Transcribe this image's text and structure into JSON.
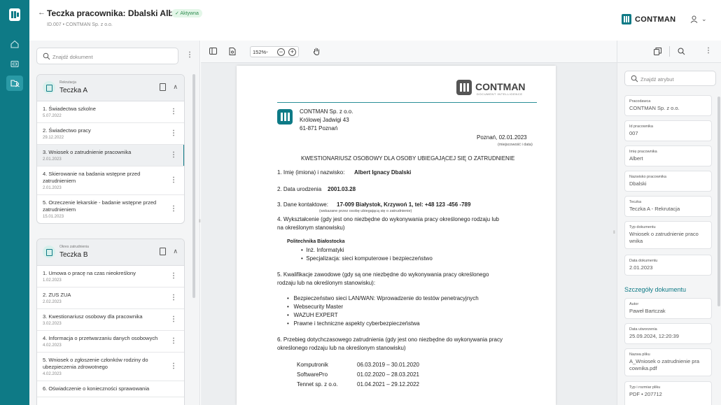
{
  "header": {
    "back_label": "←",
    "title": "Teczka pracownika: Dbalski Albert",
    "badge": "✓ Aktywna",
    "subtitle": "ID.007 • CONTMAN Sp. z o.o.",
    "brand": "CONTMAN",
    "user_chevron": "⌄"
  },
  "left_panel": {
    "search_placeholder": "Znajdź dokument",
    "groups": [
      {
        "category": "Rekrutacja",
        "name": "Teczka A",
        "items": [
          {
            "title": "1. Świadectwa szkolne",
            "date": "5.07.2022"
          },
          {
            "title": "2. Świadectwo pracy",
            "date": "29.12.2022"
          },
          {
            "title": "3. Wniosek o zatrudnienie pracownika",
            "date": "2.01.2023"
          },
          {
            "title": "4. Skierowanie na badania wstępne przed zatrudnieniem",
            "date": "2.01.2023"
          },
          {
            "title": "5. Orzeczenie lekarskie - badanie wstępne przed zatrudnieniem",
            "date": "15.01.2023"
          }
        ]
      },
      {
        "category": "Okres zatrudnienia",
        "name": "Teczka B",
        "items": [
          {
            "title": "1. Umowa o pracę na czas nieokreślony",
            "date": "1.02.2023"
          },
          {
            "title": "2. ZUS ZUA",
            "date": "2.02.2023"
          },
          {
            "title": "3. Kwestionariusz osobowy dla pracownika",
            "date": "3.02.2023"
          },
          {
            "title": "4. Informacja o przetwarzaniu danych osobowych",
            "date": "4.02.2023"
          },
          {
            "title": "5. Wniosek o zgłoszenie członków rodziny do ubezpieczenia zdrowotnego",
            "date": "4.02.2023"
          },
          {
            "title": "6. Oświadczenie o konieczności sprawowania",
            "date": ""
          }
        ]
      }
    ]
  },
  "viewer": {
    "zoom": "152%",
    "zoom_chevron": "⌄",
    "zoom_out": "−",
    "zoom_in": "+",
    "document": {
      "logo_text": "CONTMAN",
      "logo_sub": "DOCUMENT INTELLIGENCE",
      "sender_name": "CONTMAN Sp. z o.o.",
      "sender_street": "Królowej Jadwigi 43",
      "sender_city": "61-871 Poznań",
      "place_date": "Poznań, 02.01.2023",
      "place_date_hint": "(miejscowość i data)",
      "heading": "KWESTIONARIUSZ OSOBOWY DLA OSOBY UBIEGAJĄCEJ SIĘ O ZATRUDNIENIE",
      "q1_label": "1. Imię (imiona) i nazwisko:",
      "q1_value": "Albert Ignacy Dbalski",
      "q2_label": "2. Data urodzenia",
      "q2_value": "2001.03.28",
      "q3_label": "3. Dane kontaktowe:",
      "q3_value": "17-009 Białystok, Krzywoń 1, tel: +48 123 -456 -789",
      "q3_hint": "(wskazane przez osobę ubiegającą się o zatrudnienie)",
      "q4_line1": "4. Wykształcenie (gdy jest ono niezbędne do wykonywania pracy określonego rodzaju lub",
      "q4_line2": "na określonym stanowisku)",
      "school": "Politechnika Białostocka",
      "school_items": [
        "Inż. Informatyki",
        "Specjalizacja: sieci komputerowe i bezpieczeństwo"
      ],
      "q5_line1": "5. Kwalifikacje zawodowe (gdy są one niezbędne do wykonywania pracy określonego",
      "q5_line2": "rodzaju lub na określonym stanowisku):",
      "qualifications": [
        "Bezpieczeństwo sieci LAN/WAN: Wprowadzenie do testów penetracyjnych",
        "Websecurity Master",
        "WAZUH EXPERT",
        "Prawne i techniczne aspekty cyberbezpieczeństwa"
      ],
      "q6_line1": "6. Przebieg dotychczasowego zatrudnienia (gdy jest ono niezbędne do wykonywania pracy",
      "q6_line2": "określonego rodzaju lub na określonym stanowisku)",
      "employment": [
        {
          "company": "Komputronik",
          "period": "06.03.2019 – 30.01.2020"
        },
        {
          "company": "SoftwarePro",
          "period": "01.02.2020 – 28.03.2021"
        },
        {
          "company": "Tennet sp. z o.o.",
          "period": "01.04.2021 – 29.12.2022"
        }
      ]
    }
  },
  "right_panel": {
    "search_placeholder": "Znajdź atrybut",
    "attributes": [
      {
        "label": "Pracodawca",
        "value": "CONTMAN Sp. z o.o."
      },
      {
        "label": "Id pracownika",
        "value": "007"
      },
      {
        "label": "Imię pracownika",
        "value": "Albert"
      },
      {
        "label": "Nazwisko pracownika",
        "value": "Dbalski"
      },
      {
        "label": "Teczka",
        "value": "Teczka A - Rekrutacja"
      },
      {
        "label": "Typ dokumentu",
        "value": "Wniosek o zatrudnienie praco wnika"
      },
      {
        "label": "Data dokumentu",
        "value": "2.01.2023"
      }
    ],
    "details_title": "Szczegóły dokumentu",
    "details": [
      {
        "label": "Autor",
        "value": "Paweł Bartczak"
      },
      {
        "label": "Data utworzenia",
        "value": "25.09.2024, 12:20:39"
      },
      {
        "label": "Nazwa pliku",
        "value": "A_Wniosek o zatrudnienie pra cownika.pdf"
      },
      {
        "label": "Typ i rozmiar pliku",
        "value": "PDF • 207712"
      }
    ]
  },
  "colors": {
    "accent": "#0e7a86",
    "badge_bg": "#e3f6e8",
    "badge_fg": "#2e8b4f"
  }
}
